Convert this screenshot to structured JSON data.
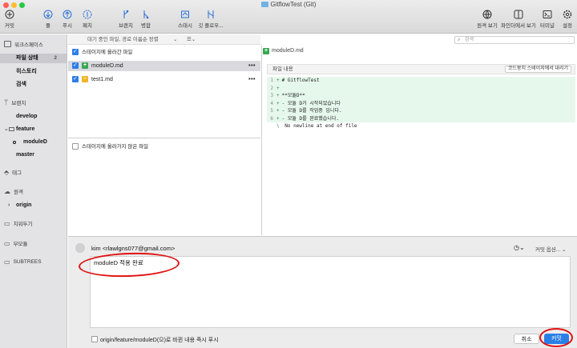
{
  "window": {
    "title": "GitflowTest (Git)"
  },
  "toolbar": {
    "commit": "커밋",
    "pull": "풀",
    "push": "푸시",
    "fetch": "페치",
    "branch": "브랜치",
    "merge": "병합",
    "stash": "스태시",
    "gitflow": "깃 플로우...",
    "remote_view": "원격 보기",
    "finder_view": "파인더에서 보기",
    "terminal": "터미널",
    "settings": "설정"
  },
  "sidebar": {
    "workspace": "워크스페이스",
    "file_status": "파일 상태",
    "file_status_count": "2",
    "history": "히스토리",
    "search": "검색",
    "branches": "브랜치",
    "develop": "develop",
    "feature": "feature",
    "moduleD": "moduleD",
    "master": "master",
    "tags": "태그",
    "remotes": "원격",
    "origin": "origin",
    "stashes": "치워두기",
    "submodules": "부모듈",
    "subtrees": "SUBTREES"
  },
  "filelist": {
    "filter": "대기 중인 파일, 경로 이름순 정렬",
    "staged_header": "스테이지에 올라간 파일",
    "files": [
      {
        "name": "moduleD.md",
        "status": "added"
      },
      {
        "name": "test1.md",
        "status": "modified"
      }
    ],
    "unstaged_header": "스테이지에 올라가지 않은 파일"
  },
  "search": {
    "placeholder": "검색"
  },
  "diff": {
    "file": "moduleD.md",
    "hunk_label": "파일 내용",
    "hunk_button": "코드뭉치 스테이지에서 내리기",
    "lines": [
      {
        "n": "1",
        "sign": "+",
        "text": "# GitflowTest"
      },
      {
        "n": "2",
        "sign": "+",
        "text": ""
      },
      {
        "n": "3",
        "sign": "+",
        "text": "**모듈D**"
      },
      {
        "n": "4",
        "sign": "+",
        "text": "- 모듈 D가 시작되었습니다"
      },
      {
        "n": "5",
        "sign": "+",
        "text": "- 모듈 D를 작업중 입니다."
      },
      {
        "n": "6",
        "sign": "+",
        "text": "- 모듈 D를 완료했습니다."
      },
      {
        "n": "",
        "sign": "\\",
        "text": " No newline at end of file"
      }
    ]
  },
  "commit": {
    "author": "kim <rlawlgns077@gmail.com>",
    "options": "커밋 옵션...",
    "message": "moduleD 적용 완료",
    "push_option": "origin/feature/moduleD(으)로 바뀐 내용 즉시 푸시",
    "cancel": "취소",
    "commit": "커밋"
  },
  "colors": {
    "accent": "#2a7fe6",
    "added": "#3aa655",
    "modified": "#f0b429",
    "annotation": "#e01010"
  }
}
